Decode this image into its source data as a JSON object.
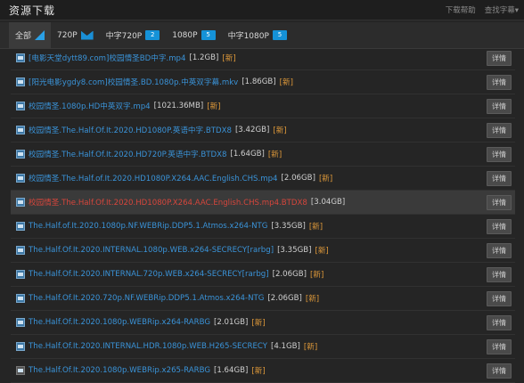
{
  "header": {
    "title": "资源下载",
    "links": [
      "下载帮助",
      "查找字幕▾"
    ]
  },
  "tabs": [
    {
      "label": "全部",
      "icon": "corner-icon",
      "badge": ""
    },
    {
      "label": "720P",
      "icon": "wing-icon",
      "badge": ""
    },
    {
      "label": "中字720P",
      "icon": "",
      "badge": "2"
    },
    {
      "label": "1080P",
      "icon": "",
      "badge": "5"
    },
    {
      "label": "中字1080P",
      "icon": "",
      "badge": "5"
    }
  ],
  "detail_label": "详情",
  "rows": [
    {
      "name": "[电影天堂dytt89.com]校园情圣BD中字.mp4",
      "size": "[1.2GB]",
      "new": "[新]",
      "highlight": false
    },
    {
      "name": "[阳光电影ygdy8.com]校园情圣.BD.1080p.中英双字幕.mkv",
      "size": "[1.86GB]",
      "new": "[新]",
      "highlight": false
    },
    {
      "name": "校园情圣.1080p.HD中英双字.mp4",
      "size": "[1021.36MB]",
      "new": "[新]",
      "highlight": false
    },
    {
      "name": "校园情圣.The.Half.Of.It.2020.HD1080P.英语中字.BTDX8",
      "size": "[3.42GB]",
      "new": "[新]",
      "highlight": false
    },
    {
      "name": "校园情圣.The.Half.Of.It.2020.HD720P.英语中字.BTDX8",
      "size": "[1.64GB]",
      "new": "[新]",
      "highlight": false
    },
    {
      "name": "校园情圣.The.Half.of.It.2020.HD1080P.X264.AAC.English.CHS.mp4",
      "size": "[2.06GB]",
      "new": "[新]",
      "highlight": false
    },
    {
      "name": "校园情圣.The.Half.Of.It.2020.HD1080P.X264.AAC.English.CHS.mp4.BTDX8",
      "size": "[3.04GB]",
      "new": "",
      "highlight": true
    },
    {
      "name": "The.Half.of.It.2020.1080p.NF.WEBRip.DDP5.1.Atmos.x264-NTG",
      "size": "[3.35GB]",
      "new": "[新]",
      "highlight": false
    },
    {
      "name": "The.Half.Of.It.2020.INTERNAL.1080p.WEB.x264-SECRECY[rarbg]",
      "size": "[3.35GB]",
      "new": "[新]",
      "highlight": false
    },
    {
      "name": "The.Half.Of.It.2020.INTERNAL.720p.WEB.x264-SECRECY[rarbg]",
      "size": "[2.06GB]",
      "new": "[新]",
      "highlight": false
    },
    {
      "name": "The.Half.Of.It.2020.720p.NF.WEBRip.DDP5.1.Atmos.x264-NTG",
      "size": "[2.06GB]",
      "new": "[新]",
      "highlight": false
    },
    {
      "name": "The.Half.Of.It.2020.1080p.WEBRip.x264-RARBG",
      "size": "[2.01GB]",
      "new": "[新]",
      "highlight": false
    },
    {
      "name": "The.Half.Of.It.2020.INTERNAL.HDR.1080p.WEB.H265-SECRECY",
      "size": "[4.1GB]",
      "new": "[新]",
      "highlight": false
    },
    {
      "name": "The.Half.Of.It.2020.1080p.WEBRip.x265-RARBG",
      "size": "[1.64GB]",
      "new": "[新]",
      "highlight": false
    }
  ]
}
